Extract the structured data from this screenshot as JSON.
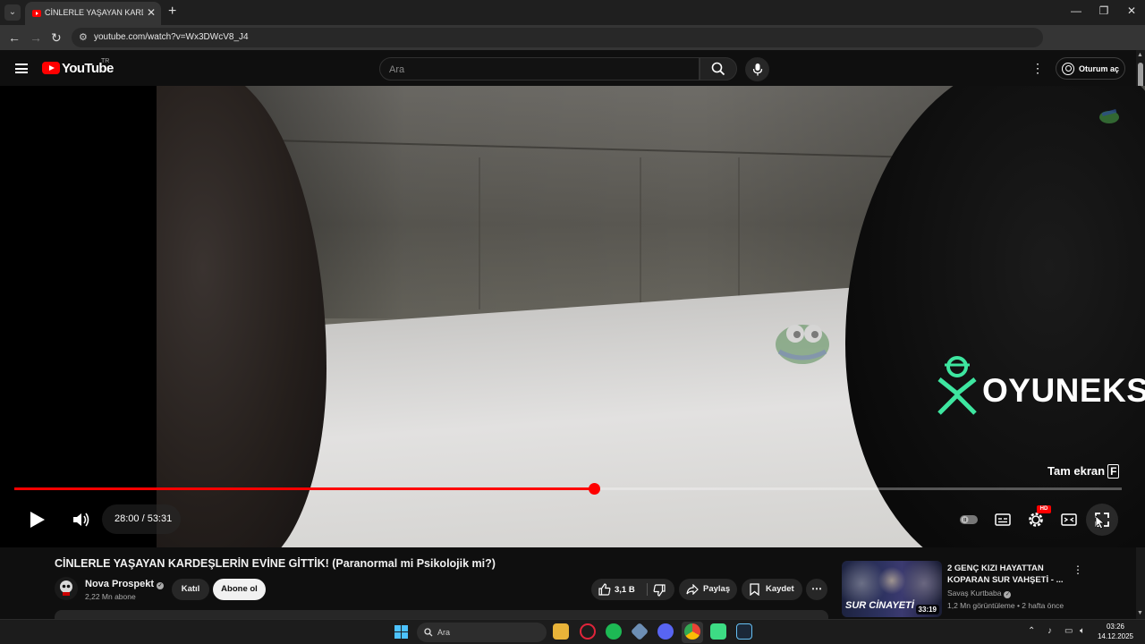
{
  "browser": {
    "tab_title": "CİNLERLE YAŞAYAN KARDEŞLER",
    "tab_close": "✕",
    "new_tab": "+",
    "url": "youtube.com/watch?v=Wx3DWcV8_J4",
    "window_controls": {
      "minimize": "—",
      "restore": "❐",
      "close": "✕"
    }
  },
  "yt_header": {
    "logo": "YouTube",
    "region": "TR",
    "search_placeholder": "Ara",
    "signin_label": "Oturum aç"
  },
  "player": {
    "fullscreen_tooltip": "Tam ekran",
    "fullscreen_key": "F",
    "time_display": "28:00 / 53:31",
    "progress_fraction": 0.5238,
    "hd_badge": "HD",
    "watermark": "OYUNEKS"
  },
  "video": {
    "title": "CİNLERLE YAŞAYAN KARDEŞLERİN EVİNE GİTTİK! (Paranormal mi Psikolojik mi?)",
    "channel_name": "Nova Prospekt",
    "subscribers": "2,22 Mn abone",
    "join_label": "Katıl",
    "subscribe_label": "Abone ol",
    "likes": "3,1 B",
    "share_label": "Paylaş",
    "save_label": "Kaydet"
  },
  "recommendation": {
    "title": "2 GENÇ KIZI HAYATTAN KOPARAN SUR VAHŞETİ - ...",
    "channel": "Savaş Kurtbaba",
    "meta": "1,2 Mn görüntüleme • 2 hafta önce",
    "thumb_text": "SUR CİNAYETİ",
    "duration": "33:19"
  },
  "taskbar": {
    "search_placeholder": "Ara",
    "time": "03:26",
    "date": "14.12.2025"
  },
  "colors": {
    "accent_red": "#ff0000",
    "background": "#0f0f0f",
    "watermark_green": "#3ee6a0"
  }
}
